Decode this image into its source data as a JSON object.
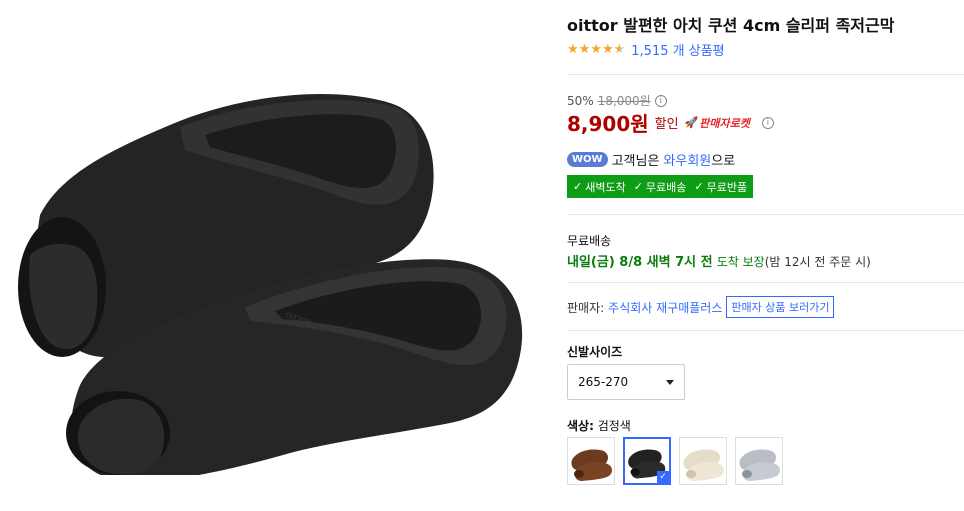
{
  "product": {
    "title": "oittor 발편한 아치 쿠션 4cm 슬리퍼 족저근막",
    "rating": 4.5,
    "review_count": "1,515 개 상품평",
    "color_main": "#2a2a2a"
  },
  "price": {
    "discount_rate": "50%",
    "original_price": "18,000원",
    "sale_price": "8,900원",
    "discount_label": "할인",
    "rocket_badge": "판매자로켓",
    "info_icon": "i"
  },
  "membership": {
    "badge": "WOW",
    "text_prefix": "고객님은",
    "link": "와우회원",
    "text_suffix": "으로",
    "benefits": [
      "새벽도착",
      "무료배송",
      "무료반품"
    ]
  },
  "shipping": {
    "label": "무료배송",
    "arrival": "내일(금) 8/8 새벽 7시 전",
    "guarantee": "도착 보장",
    "note": "(밤 12시 전 주문 시)"
  },
  "seller": {
    "label": "판매자:",
    "name": "주식회사 재구매플러스",
    "button": "판매자 상품 보러가기"
  },
  "size": {
    "label": "신발사이즈",
    "selected": "265-270"
  },
  "color": {
    "label": "색상:",
    "selected": "검정색",
    "swatches": [
      "brown-slipper",
      "black-slipper",
      "beige-slipper",
      "gray-slipper"
    ]
  },
  "colors": {
    "accent": "#346aff",
    "price_red": "#ae0000",
    "benefit_green": "#0f9d17",
    "star": "#f5a623"
  }
}
